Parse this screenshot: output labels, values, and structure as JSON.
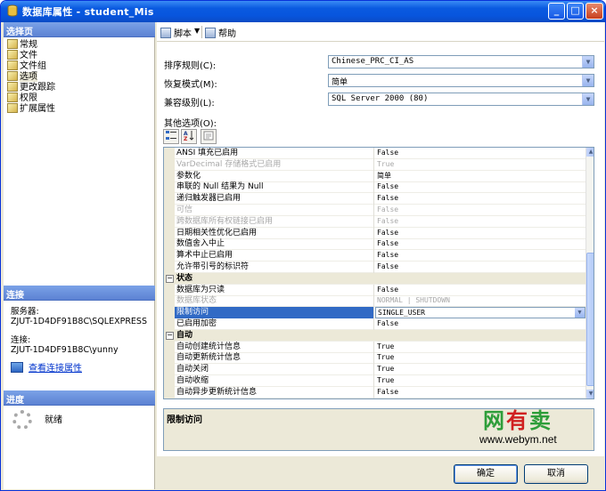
{
  "window": {
    "title": "数据库属性 - student_Mis"
  },
  "left": {
    "select_header": "选择页",
    "nav_items": [
      {
        "label": "常规"
      },
      {
        "label": "文件"
      },
      {
        "label": "文件组"
      },
      {
        "label": "选项"
      },
      {
        "label": "更改跟踪"
      },
      {
        "label": "权限"
      },
      {
        "label": "扩展属性"
      }
    ],
    "selected_index": 3,
    "connection_header": "连接",
    "server_label": "服务器:",
    "server_value": "ZJUT-1D4DF91B8C\\SQLEXPRESS",
    "connection_label": "连接:",
    "connection_value": "ZJUT-1D4DF91B8C\\yunny",
    "view_connection_link": "查看连接属性",
    "progress_header": "进度",
    "progress_status": "就绪"
  },
  "toolbar": {
    "script_label": "脚本",
    "dropdown_glyph": "▼",
    "help_label": "帮助"
  },
  "fields": {
    "collation_label": "排序规则(C):",
    "collation_value": "Chinese_PRC_CI_AS",
    "recovery_label": "恢复模式(M):",
    "recovery_value": "简单",
    "compat_label": "兼容级别(L):",
    "compat_value": "SQL Server 2000 (80)",
    "other_options_label": "其他选项(O):"
  },
  "grid": {
    "rows": [
      {
        "kind": "prop",
        "name": "ANSI 填充已启用",
        "value": "False"
      },
      {
        "kind": "prop",
        "name": "VarDecimal 存储格式已启用",
        "value": "True",
        "disabled": true
      },
      {
        "kind": "prop",
        "name": "参数化",
        "value": "简单"
      },
      {
        "kind": "prop",
        "name": "串联的 Null 结果为 Null",
        "value": "False"
      },
      {
        "kind": "prop",
        "name": "递归触发器已启用",
        "value": "False"
      },
      {
        "kind": "prop",
        "name": "可信",
        "value": "False",
        "disabled": true
      },
      {
        "kind": "prop",
        "name": "跨数据库所有权链接已启用",
        "value": "False",
        "disabled": true
      },
      {
        "kind": "prop",
        "name": "日期相关性优化已启用",
        "value": "False"
      },
      {
        "kind": "prop",
        "name": "数值舍入中止",
        "value": "False"
      },
      {
        "kind": "prop",
        "name": "算术中止已启用",
        "value": "False"
      },
      {
        "kind": "prop",
        "name": "允许带引号的标识符",
        "value": "False"
      },
      {
        "kind": "category",
        "name": "状态",
        "toggle": "⊟"
      },
      {
        "kind": "prop",
        "name": "数据库为只读",
        "value": "False"
      },
      {
        "kind": "prop",
        "name": "数据库状态",
        "value": "NORMAL | SHUTDOWN",
        "disabled": true
      },
      {
        "kind": "prop",
        "name": "限制访问",
        "value": "SINGLE_USER",
        "selected": true
      },
      {
        "kind": "prop",
        "name": "已启用加密",
        "value": "False"
      },
      {
        "kind": "category",
        "name": "自动",
        "toggle": "⊟"
      },
      {
        "kind": "prop",
        "name": "自动创建统计信息",
        "value": "True"
      },
      {
        "kind": "prop",
        "name": "自动更新统计信息",
        "value": "True"
      },
      {
        "kind": "prop",
        "name": "自动关闭",
        "value": "True"
      },
      {
        "kind": "prop",
        "name": "自动收缩",
        "value": "True"
      },
      {
        "kind": "prop",
        "name": "自动异步更新统计信息",
        "value": "False"
      }
    ]
  },
  "description": {
    "title": "限制访问"
  },
  "watermark": {
    "brand_part1": "网",
    "brand_part2": "有",
    "brand_part3": "卖",
    "url": "www.webym.net"
  },
  "buttons": {
    "ok": "确定",
    "cancel": "取消"
  }
}
